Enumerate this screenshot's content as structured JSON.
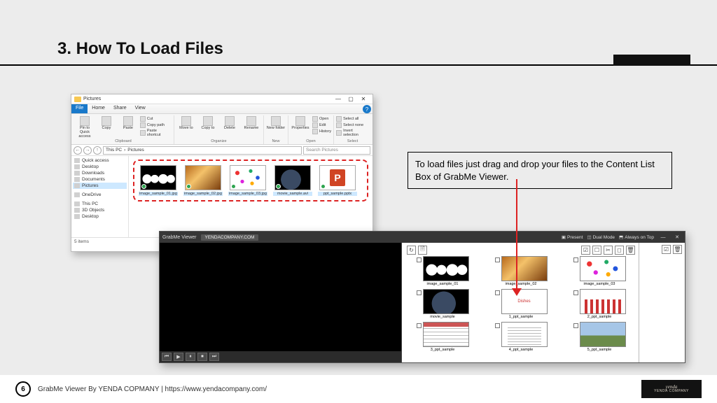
{
  "title": "3. How To Load Files",
  "callout": "To load files just drag and drop your files to the Content List Box of GrabMe Viewer.",
  "footer": {
    "page": "6",
    "text": "GrabMe Viewer By YENDA COPMANY | https://www.yendacompany.com/",
    "logo_top": "yenda",
    "logo_sub": "YENDA COMPANY"
  },
  "explorer": {
    "title": "Pictures",
    "win_min": "—",
    "win_max": "▢",
    "win_close": "✕",
    "tabs": {
      "file": "File",
      "home": "Home",
      "share": "Share",
      "view": "View"
    },
    "ribbon": {
      "clipboard": {
        "pin": "Pin to Quick access",
        "copy": "Copy",
        "paste": "Paste",
        "cut": "Cut",
        "copypath": "Copy path",
        "shortcut": "Paste shortcut",
        "caption": "Clipboard"
      },
      "organize": {
        "moveto": "Move to",
        "copyto": "Copy to",
        "del": "Delete",
        "rename": "Rename",
        "caption": "Organize"
      },
      "new": {
        "newfolder": "New folder",
        "caption": "New"
      },
      "open": {
        "props": "Properties",
        "open": "Open",
        "edit": "Edit",
        "history": "History",
        "caption": "Open"
      },
      "select": {
        "all": "Select all",
        "none": "Select none",
        "invert": "Invert selection",
        "caption": "Select"
      }
    },
    "nav": {
      "back": "←",
      "fwd": "→",
      "up": "↑",
      "path1": "This PC",
      "path2": "Pictures",
      "search": "Search Pictures"
    },
    "side": {
      "quick": "Quick access",
      "desktop": "Desktop",
      "downloads": "Downloads",
      "documents": "Documents",
      "pictures": "Pictures",
      "onedrive": "OneDrive",
      "thispc": "This PC",
      "threed": "3D Objects",
      "desktop2": "Desktop"
    },
    "files": [
      {
        "name": "image_sample_01.jpg"
      },
      {
        "name": "image_sample_02.jpg"
      },
      {
        "name": "image_sample_03.jpg"
      },
      {
        "name": "movie_sample.avi"
      },
      {
        "name": "ppt_sample.pptx"
      }
    ],
    "status": "5 items"
  },
  "gv": {
    "title": "GrabMe Viewer",
    "url": "YENDACOMPANY.COM",
    "opt_present": "Present",
    "opt_dual": "Dual Mode",
    "opt_top": "Always on Top",
    "win_min": "—",
    "win_close": "✕",
    "controls": {
      "first": "⏮",
      "play": "▶",
      "pause": "⏸",
      "stop": "⏹",
      "last": "⏭"
    },
    "tool": {
      "rotate": "↻",
      "doc": "🗎",
      "chkall": "☑",
      "chk": "☐",
      "crop": "✂",
      "frame": "◻",
      "del": "🗑"
    },
    "items": [
      {
        "name": "image_sample_01"
      },
      {
        "name": "image_sample_02"
      },
      {
        "name": "image_sample_03"
      },
      {
        "name": "movie_sample"
      },
      {
        "name": "1_ppt_sample"
      },
      {
        "name": "2_ppt_sample"
      },
      {
        "name": "3_ppt_sample"
      },
      {
        "name": "4_ppt_sample"
      },
      {
        "name": "5_ppt_sample"
      }
    ]
  }
}
